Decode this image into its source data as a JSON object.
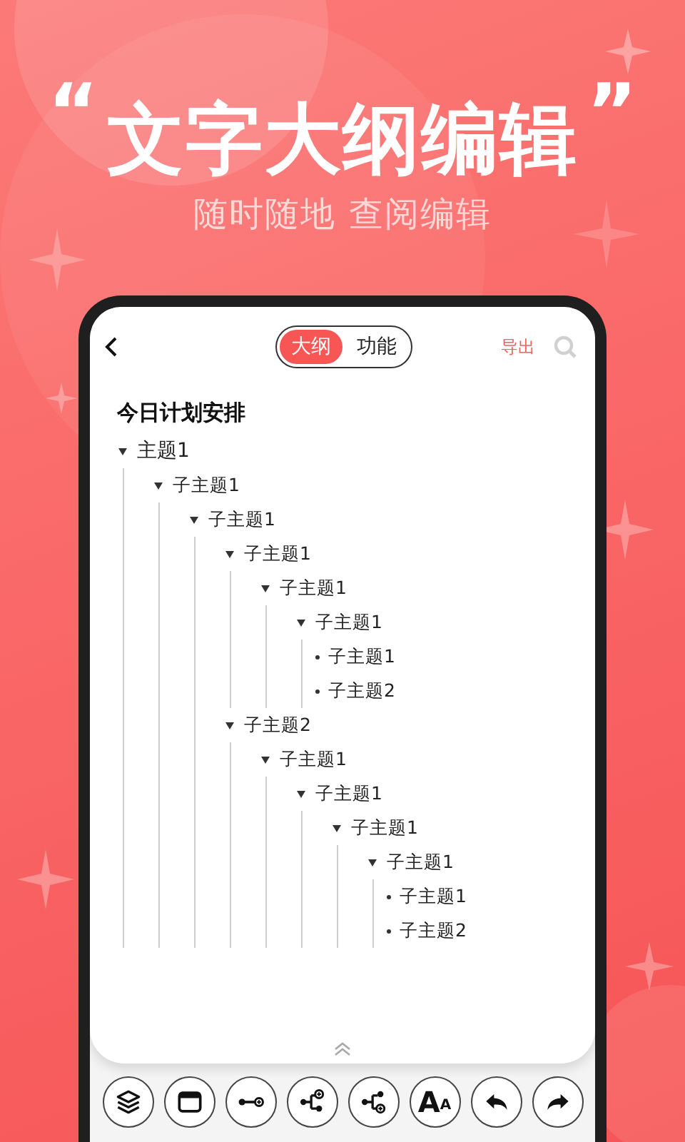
{
  "headline": {
    "open_quote": "“",
    "title": "文字大纲编辑",
    "close_quote": "”",
    "subtitle": "随时随地 查阅编辑"
  },
  "header": {
    "tabs": [
      {
        "label": "大纲",
        "selected": true
      },
      {
        "label": "功能",
        "selected": false
      }
    ],
    "export": "导出"
  },
  "document": {
    "title": "今日计划安排",
    "outline": [
      {
        "text": "主题1",
        "expanded": true,
        "children": [
          {
            "text": "子主题1",
            "expanded": true,
            "children": [
              {
                "text": "子主题1",
                "expanded": true,
                "children": [
                  {
                    "text": "子主题1",
                    "expanded": true,
                    "children": [
                      {
                        "text": "子主题1",
                        "expanded": true,
                        "children": [
                          {
                            "text": "子主题1",
                            "expanded": true,
                            "children": [
                              {
                                "text": "子主题1"
                              },
                              {
                                "text": "子主题2"
                              }
                            ]
                          }
                        ]
                      }
                    ]
                  },
                  {
                    "text": "子主题2",
                    "expanded": true,
                    "children": [
                      {
                        "text": "子主题1",
                        "expanded": true,
                        "children": [
                          {
                            "text": "子主题1",
                            "expanded": true,
                            "children": [
                              {
                                "text": "子主题1",
                                "expanded": true,
                                "children": [
                                  {
                                    "text": "子主题1",
                                    "expanded": true,
                                    "children": [
                                      {
                                        "text": "子主题1"
                                      },
                                      {
                                        "text": "子主题2"
                                      }
                                    ]
                                  }
                                ]
                              }
                            ]
                          }
                        ]
                      }
                    ]
                  }
                ]
              }
            ]
          }
        ]
      }
    ]
  },
  "toolbar": [
    {
      "kind": "layers"
    },
    {
      "kind": "window"
    },
    {
      "kind": "connect"
    },
    {
      "kind": "add-child"
    },
    {
      "kind": "add-sibling"
    },
    {
      "kind": "font",
      "label": "A",
      "sublabel": "A"
    },
    {
      "kind": "undo"
    },
    {
      "kind": "redo"
    }
  ]
}
